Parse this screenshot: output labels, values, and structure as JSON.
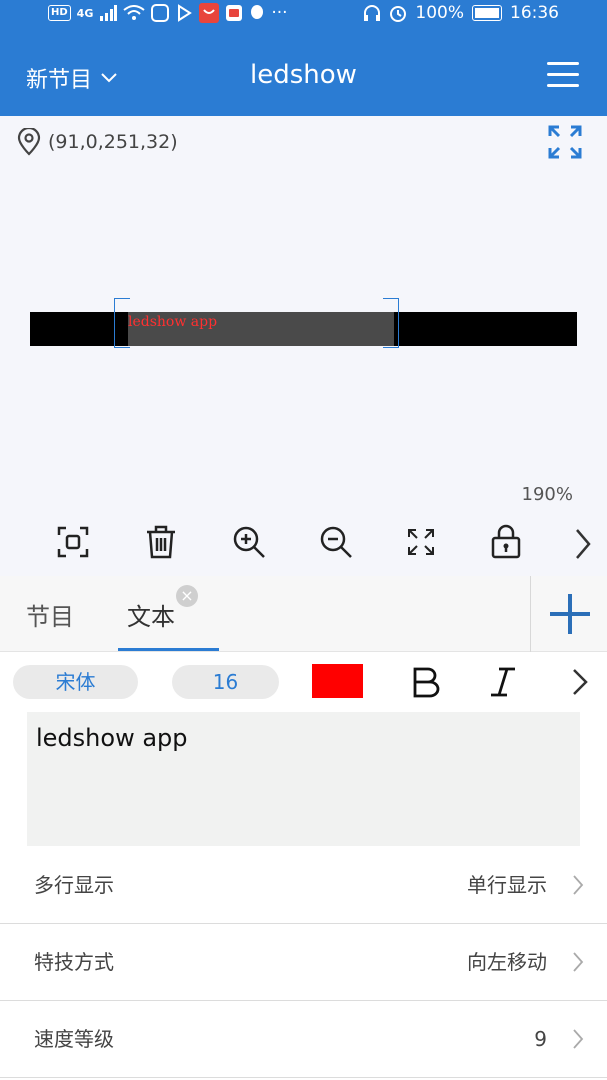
{
  "status_bar": {
    "hd": "HD",
    "network": "4G",
    "battery": "100%",
    "time": "16:36",
    "more": "···"
  },
  "header": {
    "menu_label": "新节目",
    "title": "ledshow"
  },
  "canvas": {
    "coordinates": "(91,0,251,32)",
    "led_text": "ledshow app",
    "led_text_color": "#ff3030",
    "zoom": "190%"
  },
  "toolbar": {
    "icons": [
      "select-area-icon",
      "trash-icon",
      "zoom-in-icon",
      "zoom-out-icon",
      "fit-screen-icon",
      "lock-icon",
      "chevron-right-icon"
    ]
  },
  "tabs": [
    {
      "label": "节目",
      "active": false
    },
    {
      "label": "文本",
      "active": true
    }
  ],
  "format": {
    "font": "宋体",
    "size": "16",
    "color": "#ff0000",
    "bold": "B",
    "italic": "I"
  },
  "text_content": "ledshow app",
  "settings": [
    {
      "label": "多行显示",
      "value": "单行显示"
    },
    {
      "label": "特技方式",
      "value": "向左移动"
    },
    {
      "label": "速度等级",
      "value": "9"
    }
  ],
  "colors": {
    "accent": "#2b7cd3",
    "canvas_bg": "#f5f6fb"
  }
}
